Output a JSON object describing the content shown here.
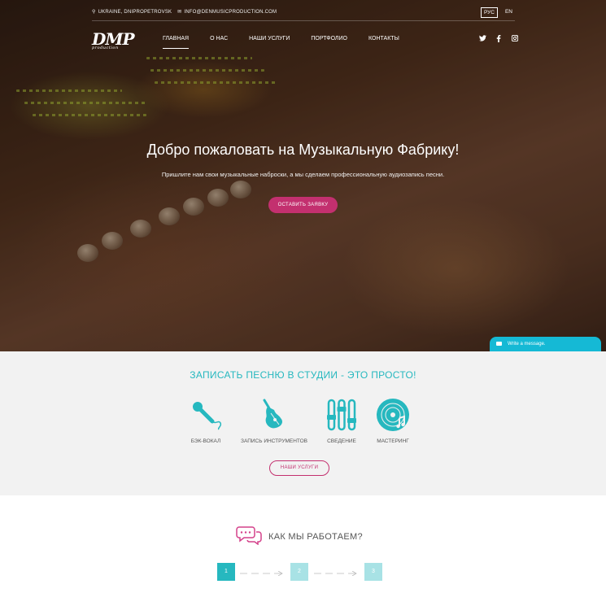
{
  "topbar": {
    "location": "UKRAINE, DNIPROPETROVSK",
    "email": "INFO@DENMUSICPRODUCTION.COM",
    "languages": [
      "РУС",
      "EN"
    ],
    "active_language": "РУС"
  },
  "logo": {
    "text": "DMP",
    "tagline": "production"
  },
  "nav": {
    "items": [
      "ГЛАВНАЯ",
      "О НАС",
      "НАШИ УСЛУГИ",
      "ПОРТФОЛИО",
      "КОНТАКТЫ"
    ],
    "active": "ГЛАВНАЯ"
  },
  "social": {
    "icons": [
      "twitter-icon",
      "facebook-icon",
      "instagram-icon"
    ]
  },
  "hero": {
    "title": "Добро пожаловать на Музыкальную Фабрику!",
    "subtitle": "Пришлите нам свои музыкальные наброски, а мы сделаем профессиональную аудиозапись песни.",
    "cta_label": "ОСТАВИТЬ ЗАЯВКУ"
  },
  "chat": {
    "label": "Write a message."
  },
  "services": {
    "title": "ЗАПИСАТЬ ПЕСНЮ В СТУДИИ - ЭТО ПРОСТО!",
    "items": [
      {
        "label": "БЭК-ВОКАЛ",
        "icon": "microphone-icon"
      },
      {
        "label": "ЗАПИСЬ ИНСТРУМЕНТОВ",
        "icon": "guitar-icon"
      },
      {
        "label": "СВЕДЕНИЕ",
        "icon": "mixer-sliders-icon"
      },
      {
        "label": "МАСТЕРИНГ",
        "icon": "vinyl-record-icon"
      }
    ],
    "button_label": "НАШИ УСЛУГИ"
  },
  "how": {
    "title": "КАК МЫ РАБОТАЕМ?",
    "steps": [
      "1",
      "2",
      "3"
    ],
    "active_step": "1"
  },
  "colors": {
    "accent": "#26b8bf",
    "brand": "#c3306f",
    "chat": "#15b9d5"
  }
}
